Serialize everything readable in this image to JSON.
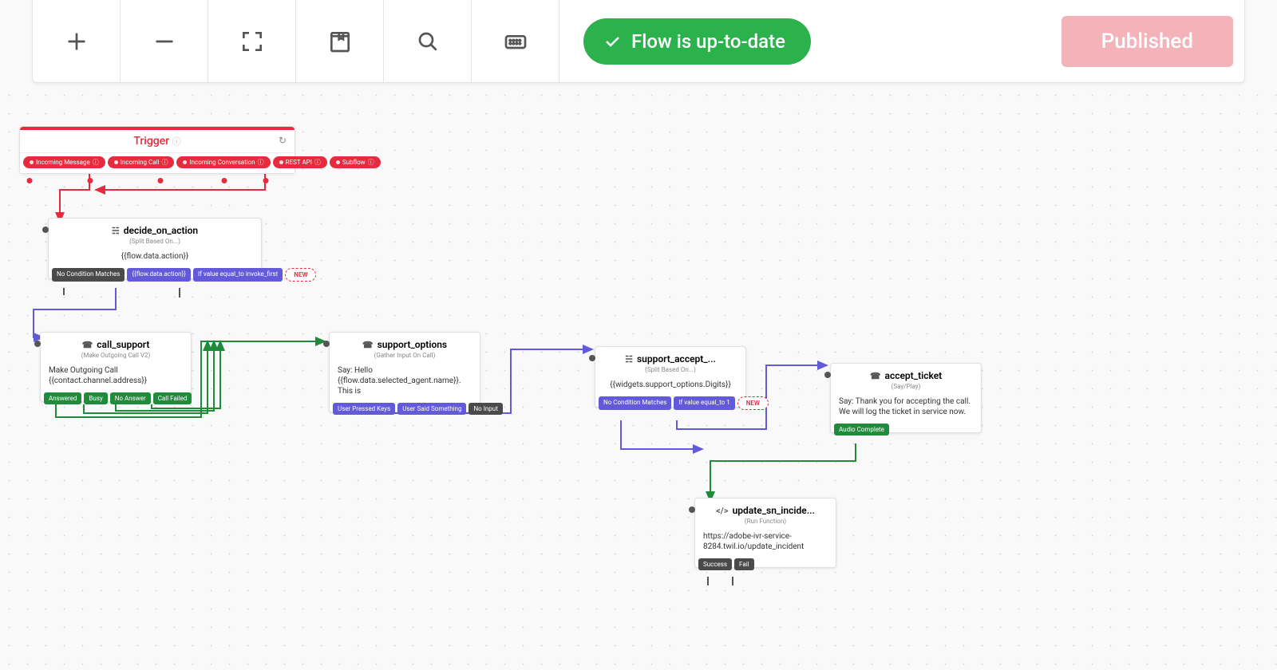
{
  "toolbar": {
    "status_label": "Flow is up-to-date",
    "publish_label": "Published"
  },
  "trigger": {
    "title": "Trigger",
    "pills": [
      "Incoming Message",
      "Incoming Call",
      "Incoming Conversation",
      "REST API",
      "Subflow"
    ]
  },
  "widgets": {
    "decide": {
      "title": "decide_on_action",
      "subtitle": "(Split Based On...)",
      "body": "{{flow.data.action}}",
      "outs": [
        "No Condition Matches",
        "{{flow.data.action}}",
        "If value equal_to invoke_first"
      ],
      "new": "NEW"
    },
    "call": {
      "title": "call_support",
      "subtitle": "(Make Outgoing Call V2)",
      "body1": "Make Outgoing Call",
      "body2": "{{contact.channel.address}}",
      "outs": [
        "Answered",
        "Busy",
        "No Answer",
        "Call Failed"
      ]
    },
    "support": {
      "title": "support_options",
      "subtitle": "(Gather Input On Call)",
      "body": "Say: Hello {{flow.data.selected_agent.name}}. This is",
      "outs": [
        "User Pressed Keys",
        "User Said Something",
        "No Input"
      ]
    },
    "accept": {
      "title": "support_accept_...",
      "subtitle": "(Split Based On...)",
      "body": "{{widgets.support_options.Digits}}",
      "outs": [
        "No Condition Matches",
        "If value equal_to 1"
      ],
      "new": "NEW"
    },
    "ticket": {
      "title": "accept_ticket",
      "subtitle": "(Say/Play)",
      "body": "Say: Thank you for accepting the call. We will log the ticket in service now.",
      "outs": [
        "Audio Complete"
      ]
    },
    "update": {
      "title": "update_sn_incide...",
      "subtitle": "(Run Function)",
      "body": "https://adobe-ivr-service-8284.twil.io/update_incident",
      "outs": [
        "Success",
        "Fail"
      ]
    }
  }
}
